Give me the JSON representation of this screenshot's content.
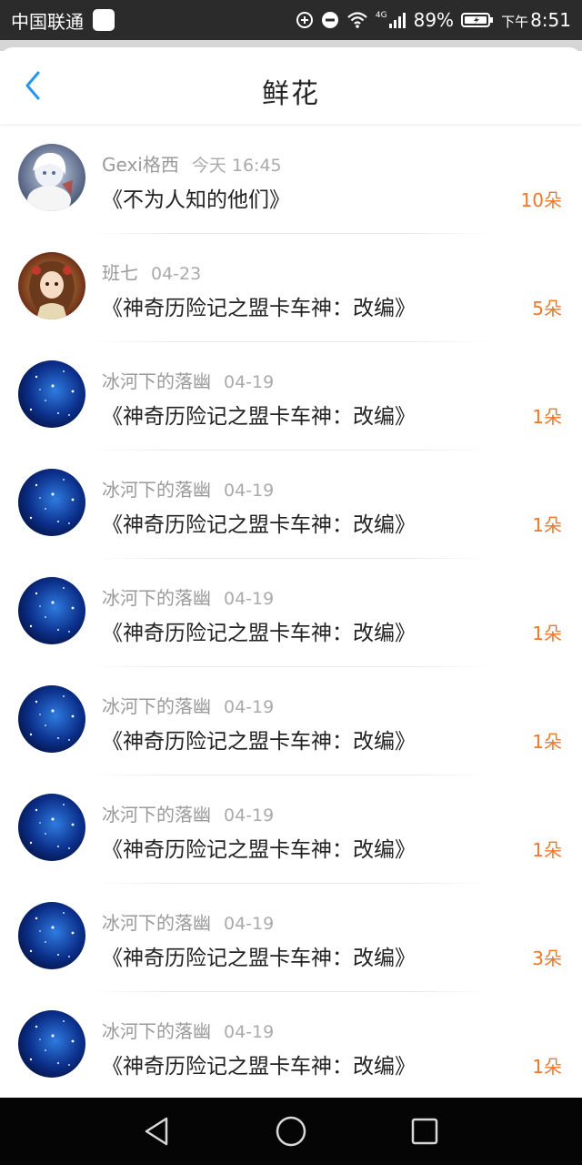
{
  "status_bar": {
    "carrier": "中国联通",
    "network": "4G",
    "battery": "89%",
    "time_prefix": "下午",
    "time": "8:51"
  },
  "header": {
    "title": "鲜花",
    "back_icon": "chevron-left-icon",
    "accent_color": "#2196f3"
  },
  "colors": {
    "count": "#f0772b"
  },
  "items": [
    {
      "user": "Gexi格西",
      "date": "今天 16:45",
      "book": "《不为人知的他们》",
      "count": "10朵",
      "avatar": "anime-white-hair"
    },
    {
      "user": "班七",
      "date": "04-23",
      "book": "《神奇历险记之盟卡车神：改编》",
      "count": "5朵",
      "avatar": "anime-brown-hair"
    },
    {
      "user": "冰河下的落幽",
      "date": "04-19",
      "book": "《神奇历险记之盟卡车神：改编》",
      "count": "1朵",
      "avatar": "starry-blue"
    },
    {
      "user": "冰河下的落幽",
      "date": "04-19",
      "book": "《神奇历险记之盟卡车神：改编》",
      "count": "1朵",
      "avatar": "starry-blue"
    },
    {
      "user": "冰河下的落幽",
      "date": "04-19",
      "book": "《神奇历险记之盟卡车神：改编》",
      "count": "1朵",
      "avatar": "starry-blue"
    },
    {
      "user": "冰河下的落幽",
      "date": "04-19",
      "book": "《神奇历险记之盟卡车神：改编》",
      "count": "1朵",
      "avatar": "starry-blue"
    },
    {
      "user": "冰河下的落幽",
      "date": "04-19",
      "book": "《神奇历险记之盟卡车神：改编》",
      "count": "1朵",
      "avatar": "starry-blue"
    },
    {
      "user": "冰河下的落幽",
      "date": "04-19",
      "book": "《神奇历险记之盟卡车神：改编》",
      "count": "3朵",
      "avatar": "starry-blue"
    },
    {
      "user": "冰河下的落幽",
      "date": "04-19",
      "book": "《神奇历险记之盟卡车神：改编》",
      "count": "1朵",
      "avatar": "starry-blue"
    }
  ],
  "nav_bar": {
    "back": "triangle-back-icon",
    "home": "circle-home-icon",
    "recents": "square-recents-icon"
  }
}
